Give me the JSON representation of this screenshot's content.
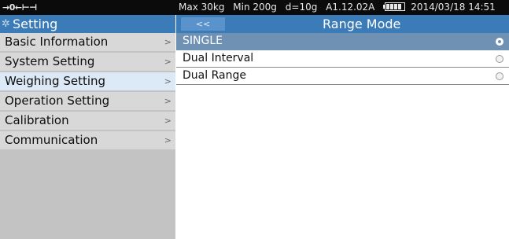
{
  "status_bar": {
    "indicator": "→0←⊢⊣",
    "max": "Max 30kg",
    "min": "Min 200g",
    "division": "d=10g",
    "version": "A1.12.02A",
    "battery_bars": 4,
    "datetime": "2014/03/18 14:51"
  },
  "sidebar": {
    "title": "Setting",
    "items": [
      {
        "label": "Basic Information",
        "active": false
      },
      {
        "label": "System Setting",
        "active": false
      },
      {
        "label": "Weighing Setting",
        "active": true
      },
      {
        "label": "Operation Setting",
        "active": false
      },
      {
        "label": "Calibration",
        "active": false
      },
      {
        "label": "Communication",
        "active": false
      }
    ],
    "chevron": ">"
  },
  "main": {
    "back_label": "<<",
    "title": "Range Mode",
    "options": [
      {
        "label": "SINGLE",
        "selected": true
      },
      {
        "label": "Dual Interval",
        "selected": false
      },
      {
        "label": "Dual Range",
        "selected": false
      }
    ]
  },
  "colors": {
    "header_blue": "#3a7bb8",
    "selected_row": "#6f91b3",
    "active_menu": "#dce9f6",
    "status_bg": "#0b0b0b"
  }
}
